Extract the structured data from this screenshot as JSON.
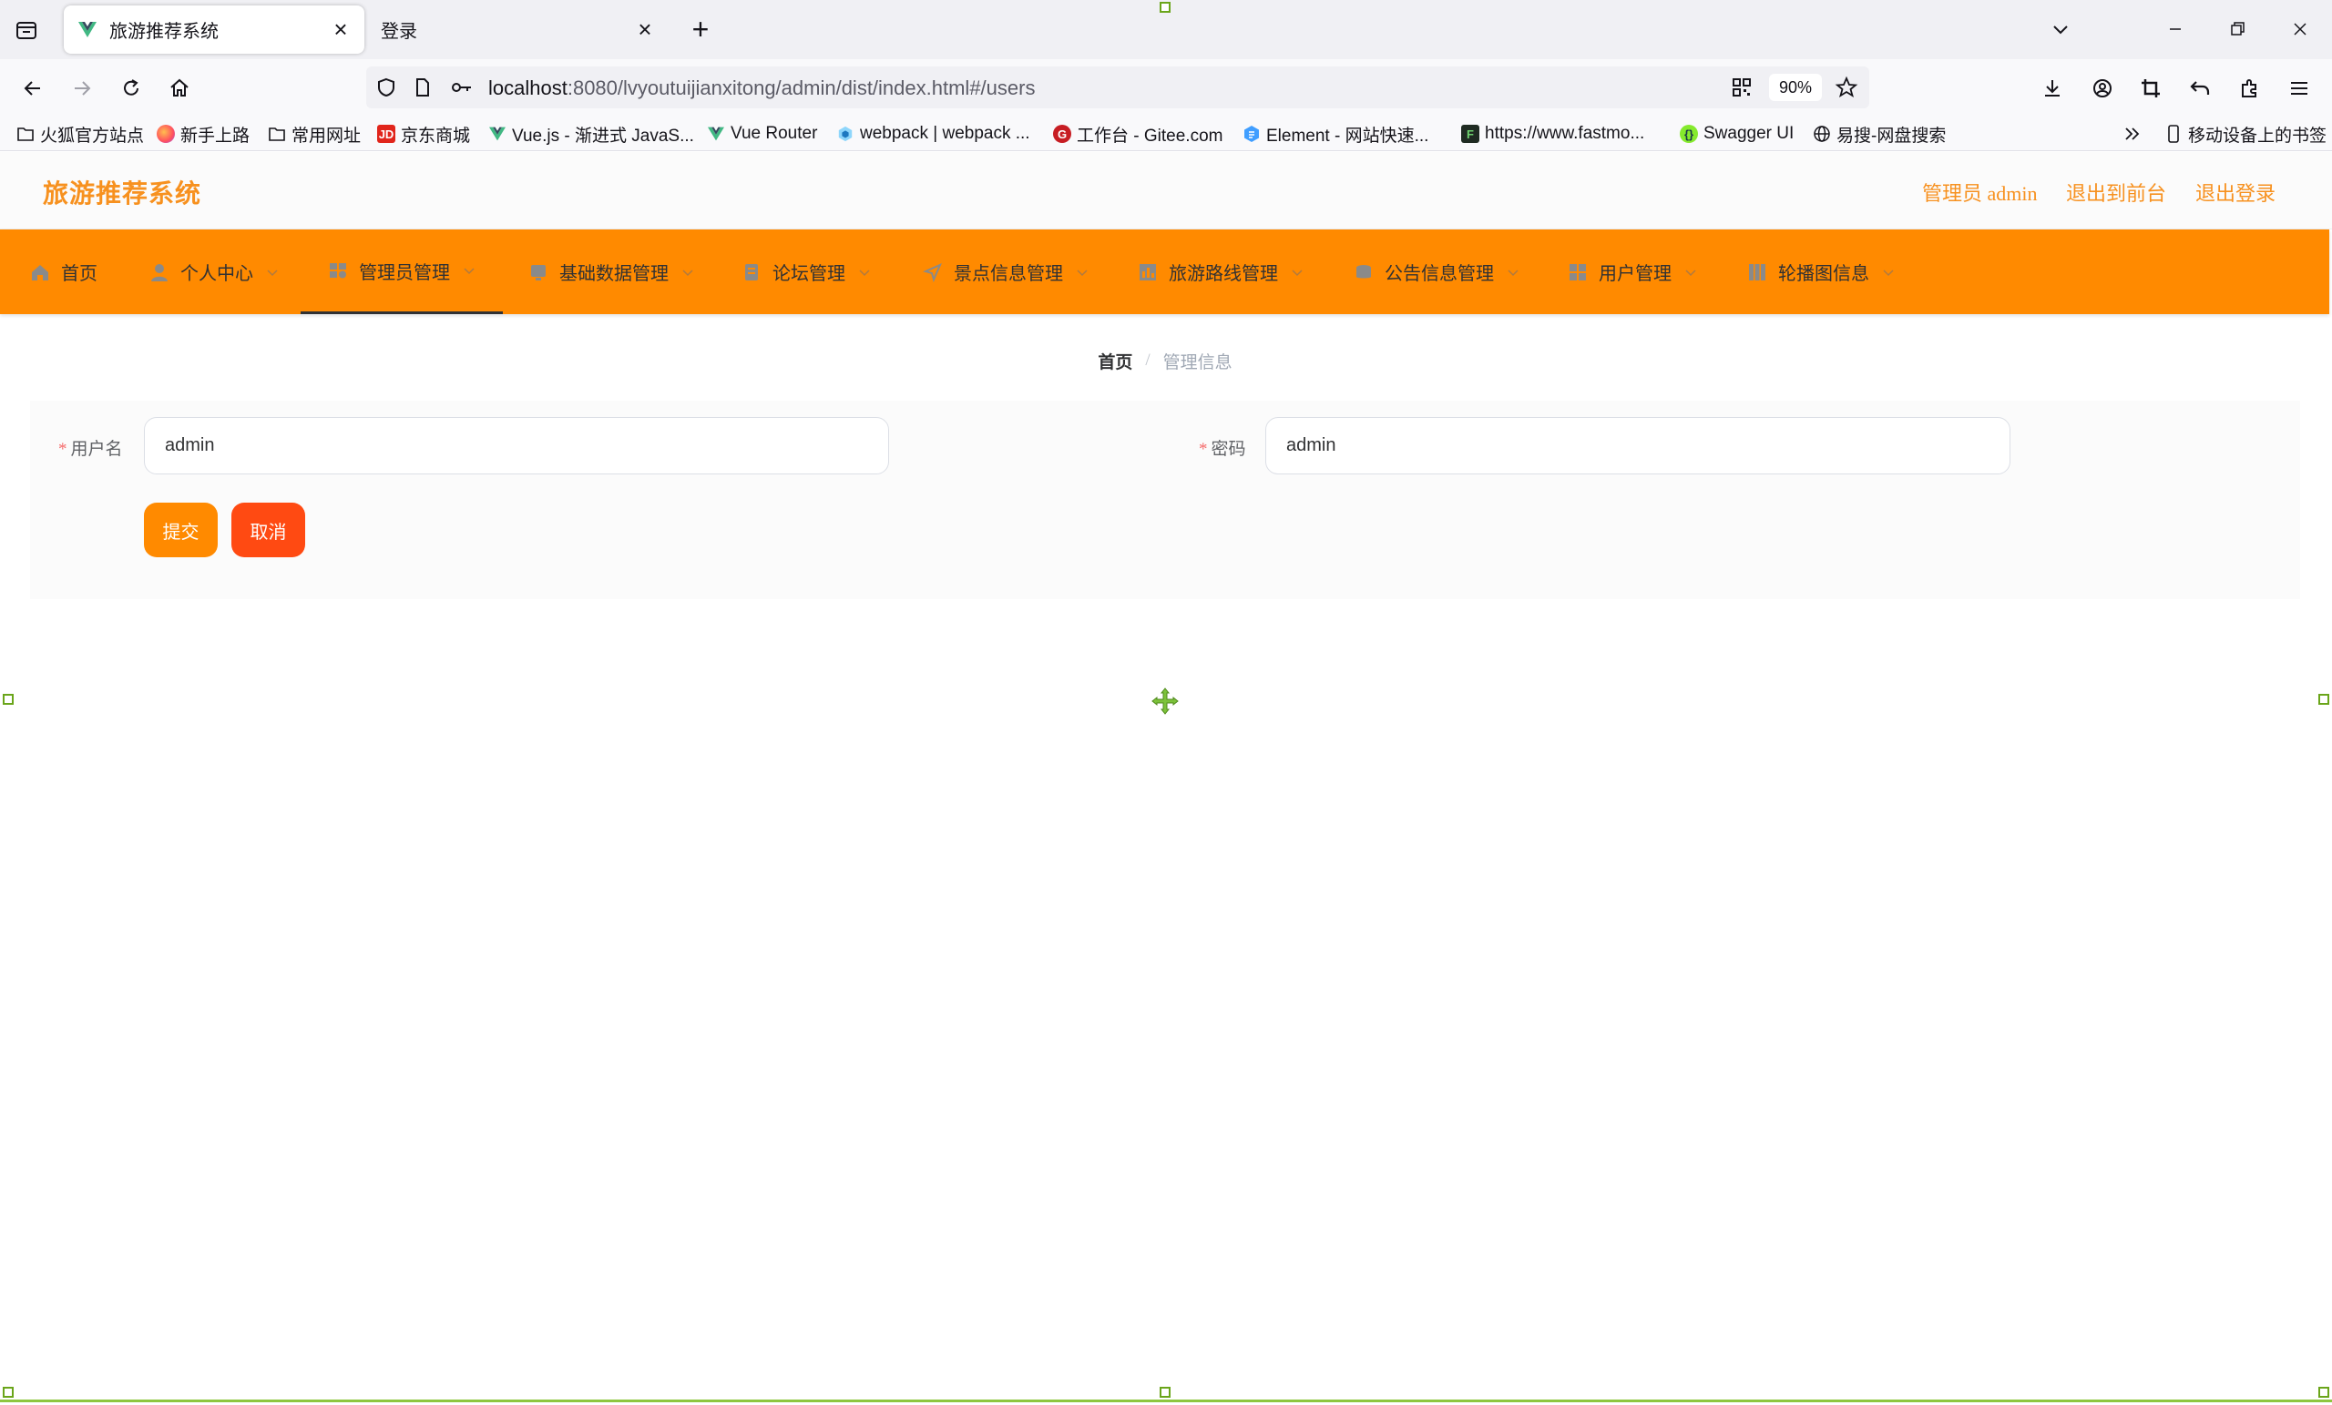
{
  "browser": {
    "tabs": [
      {
        "title": "旅游推荐系统",
        "active": true
      },
      {
        "title": "登录",
        "active": false
      }
    ],
    "url_host": "localhost",
    "url_rest": ":8080/lvyoutuijianxitong/admin/dist/index.html#/users",
    "zoom": "90%",
    "bookmarks": [
      {
        "label": "火狐官方站点",
        "icon": "folder-icon"
      },
      {
        "label": "新手上路",
        "icon": "firefox-icon"
      },
      {
        "label": "常用网址",
        "icon": "folder-icon"
      },
      {
        "label": "京东商城",
        "icon": "jd-icon"
      },
      {
        "label": "Vue.js - 渐进式 JavaS...",
        "icon": "vue-icon"
      },
      {
        "label": "Vue Router",
        "icon": "vue-icon"
      },
      {
        "label": "webpack | webpack ...",
        "icon": "webpack-icon"
      },
      {
        "label": "工作台 - Gitee.com",
        "icon": "gitee-icon"
      },
      {
        "label": "Element - 网站快速...",
        "icon": "element-icon"
      },
      {
        "label": "https://www.fastmo...",
        "icon": "fastmock-icon"
      },
      {
        "label": "Swagger UI",
        "icon": "swagger-icon"
      },
      {
        "label": "易搜-网盘搜索",
        "icon": "globe-icon"
      }
    ],
    "mobile_bookmarks": "移动设备上的书签"
  },
  "app": {
    "brand": "旅游推荐系统",
    "header_links": [
      "管理员 admin",
      "退出到前台",
      "退出登录"
    ],
    "menu": [
      {
        "label": "首页",
        "icon": "home-icon",
        "dropdown": false,
        "active": false
      },
      {
        "label": "个人中心",
        "icon": "user-icon",
        "dropdown": true,
        "active": false
      },
      {
        "label": "管理员管理",
        "icon": "admin-icon",
        "dropdown": true,
        "active": true
      },
      {
        "label": "基础数据管理",
        "icon": "data-icon",
        "dropdown": true,
        "active": false
      },
      {
        "label": "论坛管理",
        "icon": "forum-icon",
        "dropdown": true,
        "active": false
      },
      {
        "label": "景点信息管理",
        "icon": "location-icon",
        "dropdown": true,
        "active": false
      },
      {
        "label": "旅游路线管理",
        "icon": "route-icon",
        "dropdown": true,
        "active": false
      },
      {
        "label": "公告信息管理",
        "icon": "notice-icon",
        "dropdown": true,
        "active": false
      },
      {
        "label": "用户管理",
        "icon": "users-icon",
        "dropdown": true,
        "active": false
      },
      {
        "label": "轮播图信息",
        "icon": "carousel-icon",
        "dropdown": true,
        "active": false
      }
    ],
    "breadcrumb": {
      "home": "首页",
      "separator": "/",
      "current": "管理信息"
    },
    "form": {
      "username_label": "用户名",
      "username_value": "admin",
      "password_label": "密码",
      "password_value": "admin",
      "required_mark": "*",
      "submit_label": "提交",
      "cancel_label": "取消"
    },
    "colors": {
      "accent": "#ff8a00",
      "brand_text": "#f7911f",
      "cancel": "#ff4a12"
    }
  }
}
